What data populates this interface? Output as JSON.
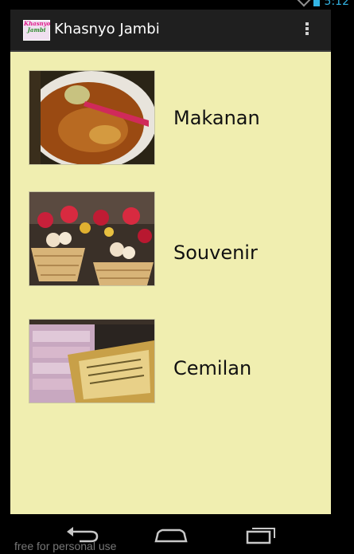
{
  "status_bar": {
    "time": "5:12"
  },
  "action_bar": {
    "app_icon_text": [
      "Khasnyo",
      "Jambi"
    ],
    "title": "Khasnyo Jambi",
    "overflow_icon": "overflow-menu-icon"
  },
  "categories": [
    {
      "label": "Makanan",
      "image": "soup-bowl-photo"
    },
    {
      "label": "Souvenir",
      "image": "souvenir-baskets-photo"
    },
    {
      "label": "Cemilan",
      "image": "snack-packages-photo"
    }
  ],
  "navigation": {
    "back": "back-arrow-icon",
    "home": "home-icon",
    "recents": "recent-apps-icon"
  },
  "watermark": "free for personal use",
  "colors": {
    "content_background": "#f0eeb0",
    "action_bar": "#1f1f1f",
    "status_accent": "#33b5e5"
  }
}
